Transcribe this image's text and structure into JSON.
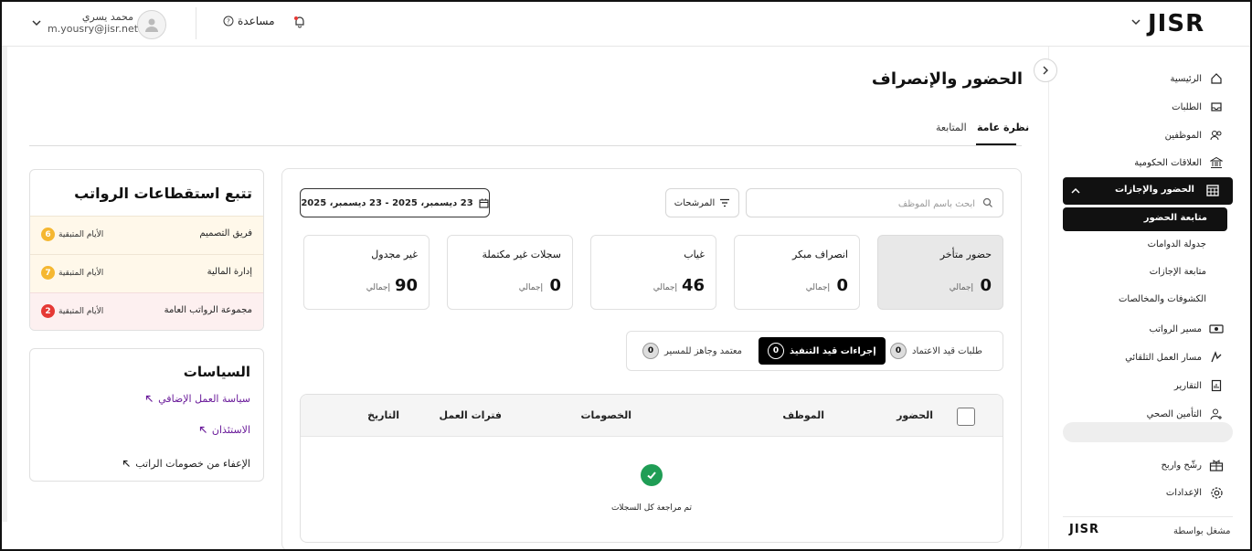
{
  "header": {
    "logo": "JISR",
    "help_label": "مساعدة",
    "user_name": "محمد يسري",
    "user_email": "m.yousry@jisr.net"
  },
  "sidebar": {
    "items": [
      {
        "label": "الرئيسية",
        "icon": "home-icon"
      },
      {
        "label": "الطلبات",
        "icon": "inbox-icon"
      },
      {
        "label": "الموظفين",
        "icon": "users-icon"
      },
      {
        "label": "العلاقات الحكومية",
        "icon": "government-building-icon"
      }
    ],
    "active_item": {
      "label": "الحضور والإجازات",
      "icon": "calendar-grid-icon"
    },
    "sub_items": [
      {
        "label": "متابعة الحضور"
      },
      {
        "label": "جدولة الدوامات"
      },
      {
        "label": "متابعة الإجازات"
      },
      {
        "label": "الكشوفات والمخالصات"
      }
    ],
    "items_after": [
      {
        "label": "مسير الرواتب",
        "icon": "money-icon"
      },
      {
        "label": "مسار العمل التلقائي",
        "icon": "workflow-icon"
      },
      {
        "label": "التقارير",
        "icon": "report-icon"
      },
      {
        "label": "التأمين الصحي",
        "icon": "health-insurance-icon"
      }
    ],
    "bottom_items": [
      {
        "label": "رشّح واربح",
        "icon": "gift-icon"
      },
      {
        "label": "الإعدادات",
        "icon": "settings-icon"
      }
    ],
    "powered_by": "مشغل بواسطة",
    "powered_logo": "JISR"
  },
  "page": {
    "title": "الحضور والإنصراف",
    "tabs": [
      {
        "label": "نظرة عامة"
      },
      {
        "label": "المتابعة"
      }
    ]
  },
  "filters": {
    "search_placeholder": "ابحث باسم الموظف",
    "filters_label": "المرشحات",
    "date_range": "23 ديسمبر، 2025 - 23 ديسمبر، 2025"
  },
  "stats": [
    {
      "title": "حضور متأخر",
      "value": "0",
      "unit": "إجمالي"
    },
    {
      "title": "انصراف مبكر",
      "value": "0",
      "unit": "إجمالي"
    },
    {
      "title": "غياب",
      "value": "46",
      "unit": "إجمالي"
    },
    {
      "title": "سجلات غير مكتملة",
      "value": "0",
      "unit": "إجمالي"
    },
    {
      "title": "غير مجدول",
      "value": "90",
      "unit": "إجمالي"
    }
  ],
  "segments": [
    {
      "label": "طلبات قيد الاعتماد",
      "count": "0"
    },
    {
      "label": "إجراءات قيد التنفيذ",
      "count": "0"
    },
    {
      "label": "معتمد وجاهز للمسير",
      "count": "0"
    }
  ],
  "table": {
    "columns": [
      "الحضور",
      "الموظف",
      "الخصومات",
      "فترات العمل",
      "التاريخ"
    ],
    "empty_message": "تم مراجعة كل السجلات"
  },
  "payroll": {
    "title": "تتبع استقطاعات الرواتب",
    "days_label": "الأيام المتبقية",
    "rows": [
      {
        "team": "فريق التصميم",
        "days": "6",
        "color": "#f5b731",
        "bg": "#fff8ea"
      },
      {
        "team": "إدارة المالية",
        "days": "7",
        "color": "#f5b731",
        "bg": "#fff8ea"
      },
      {
        "team": "مجموعة الرواتب العامة",
        "days": "2",
        "color": "#e53935",
        "bg": "#fdf0f0"
      }
    ]
  },
  "policies": {
    "title": "السياسات",
    "links": [
      {
        "label": "سياسة العمل الإضافي",
        "color": "#6a1b9a"
      },
      {
        "label": "الاستئذان",
        "color": "#6a1b9a"
      },
      {
        "label": "الإعفاء من خصومات الراتب",
        "color": "#222222"
      }
    ]
  },
  "colors": {
    "accent": "#111111",
    "success": "#1f9d55",
    "warning": "#f5b731",
    "danger": "#e53935"
  }
}
